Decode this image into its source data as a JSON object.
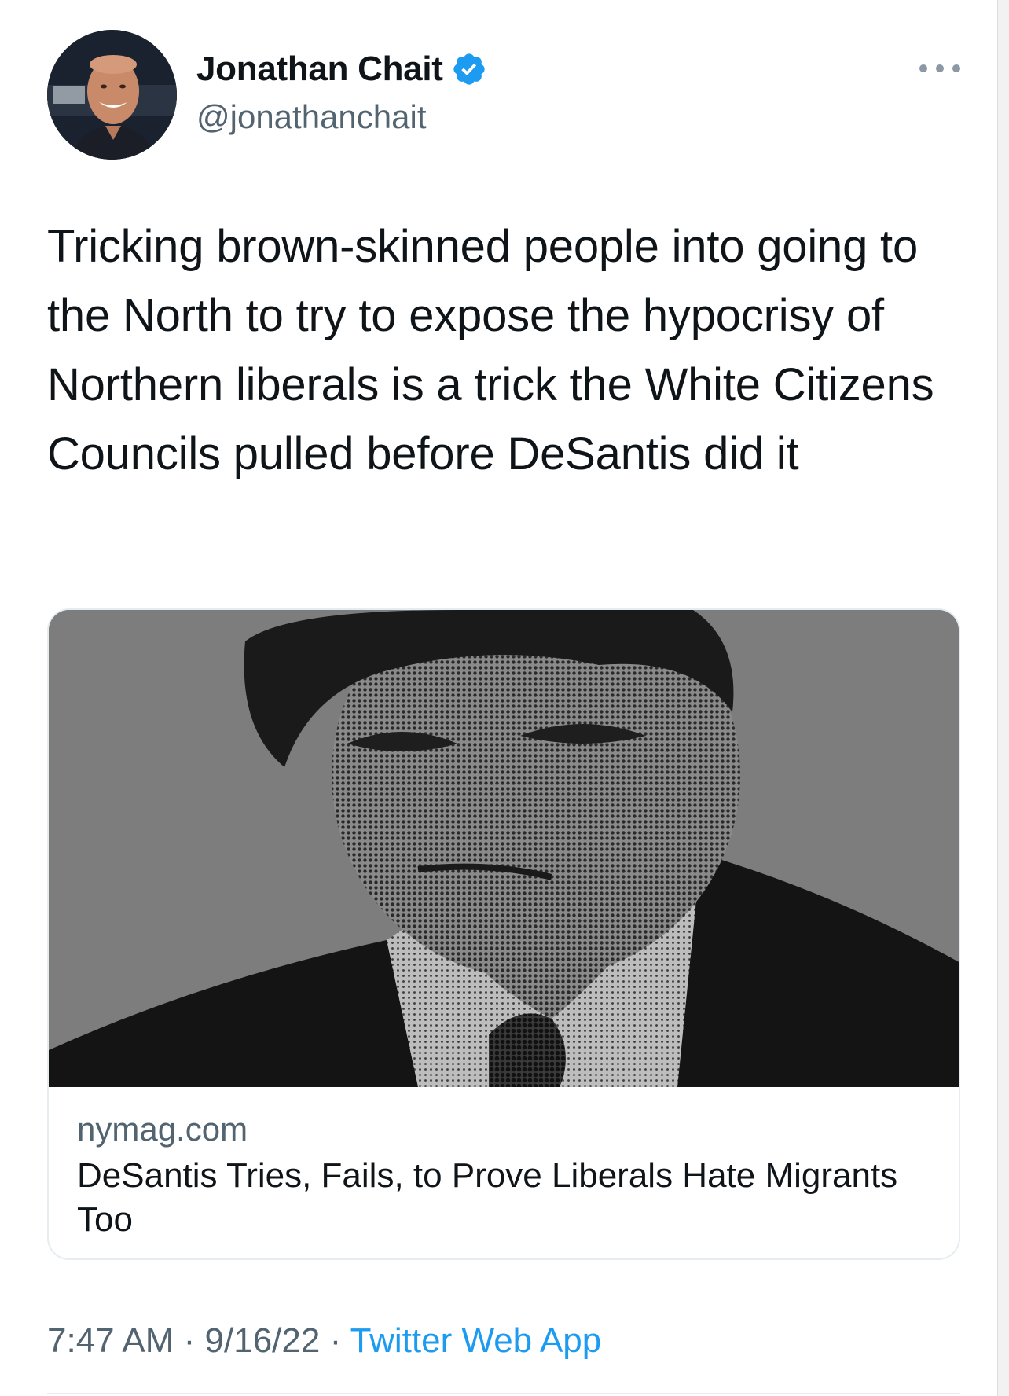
{
  "author": {
    "name": "Jonathan Chait",
    "handle": "@jonathanchait",
    "verified": true
  },
  "tweet": {
    "text": "Tricking brown-skinned people into going to the North to try to expose the hypocrisy of Northern liberals is a trick the White Citizens Councils pulled before DeSantis did it"
  },
  "link_card": {
    "domain": "nymag.com",
    "title": "DeSantis Tries, Fails, to Prove Liberals Hate Migrants Too"
  },
  "meta": {
    "time": "7:47 AM",
    "separator": " · ",
    "date": "9/16/22",
    "source": "Twitter Web App"
  },
  "icons": {
    "verified": "verified-badge-icon",
    "more": "more-options-icon"
  },
  "colors": {
    "verified_blue": "#1d9bf0",
    "link_blue": "#1d9bf0",
    "secondary_text": "#536471"
  }
}
